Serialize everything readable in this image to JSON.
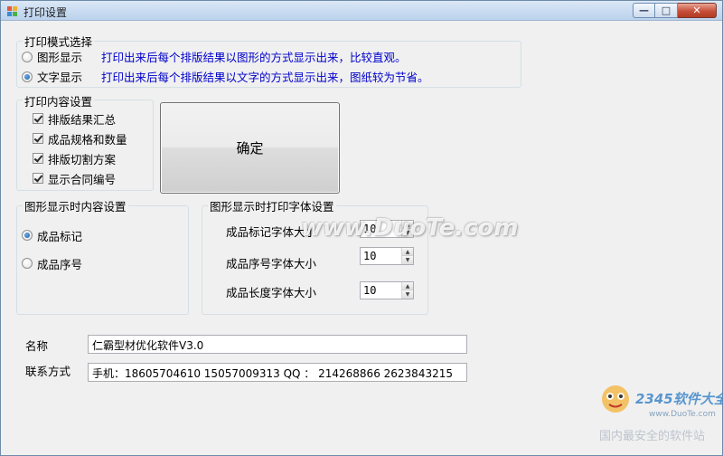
{
  "window": {
    "title": "打印设置"
  },
  "print_mode": {
    "title": "打印模式选择",
    "options": [
      {
        "label": "图形显示",
        "desc": "打印出来后每个排版结果以图形的方式显示出来，比较直观。",
        "selected": false
      },
      {
        "label": "文字显示",
        "desc": "打印出来后每个排版结果以文字的方式显示出来，图纸较为节省。",
        "selected": true
      }
    ]
  },
  "print_content": {
    "title": "打印内容设置",
    "items": [
      {
        "label": "排版结果汇总",
        "checked": true
      },
      {
        "label": "成品规格和数量",
        "checked": true
      },
      {
        "label": "排版切割方案",
        "checked": true
      },
      {
        "label": "显示合同编号",
        "checked": true
      }
    ]
  },
  "confirm_label": "确定",
  "graphic_content": {
    "title": "图形显示时内容设置",
    "options": [
      {
        "label": "成品标记",
        "selected": true
      },
      {
        "label": "成品序号",
        "selected": false
      }
    ]
  },
  "font_settings": {
    "title": "图形显示时打印字体设置",
    "rows": [
      {
        "label": "成品标记字体大小",
        "value": "10"
      },
      {
        "label": "成品序号字体大小",
        "value": "10"
      },
      {
        "label": "成品长度字体大小",
        "value": "10"
      }
    ]
  },
  "info": {
    "name_label": "名称",
    "name_value": "仁霸型材优化软件V3.0",
    "contact_label": "联系方式",
    "contact_value": "手机：18605704610    15057009313    QQ  ： 214268866    2623843215"
  },
  "watermarks": {
    "center": "www.DuoTe.com",
    "corner_brand": "2345软件大全",
    "corner_url": "www.DuoTe.com",
    "corner_tagline": "国内最安全的软件站"
  },
  "colors": {
    "desc_text": "#0000cc",
    "title_bar": "#c7daf0",
    "window_bg": "#f0f0f0"
  }
}
